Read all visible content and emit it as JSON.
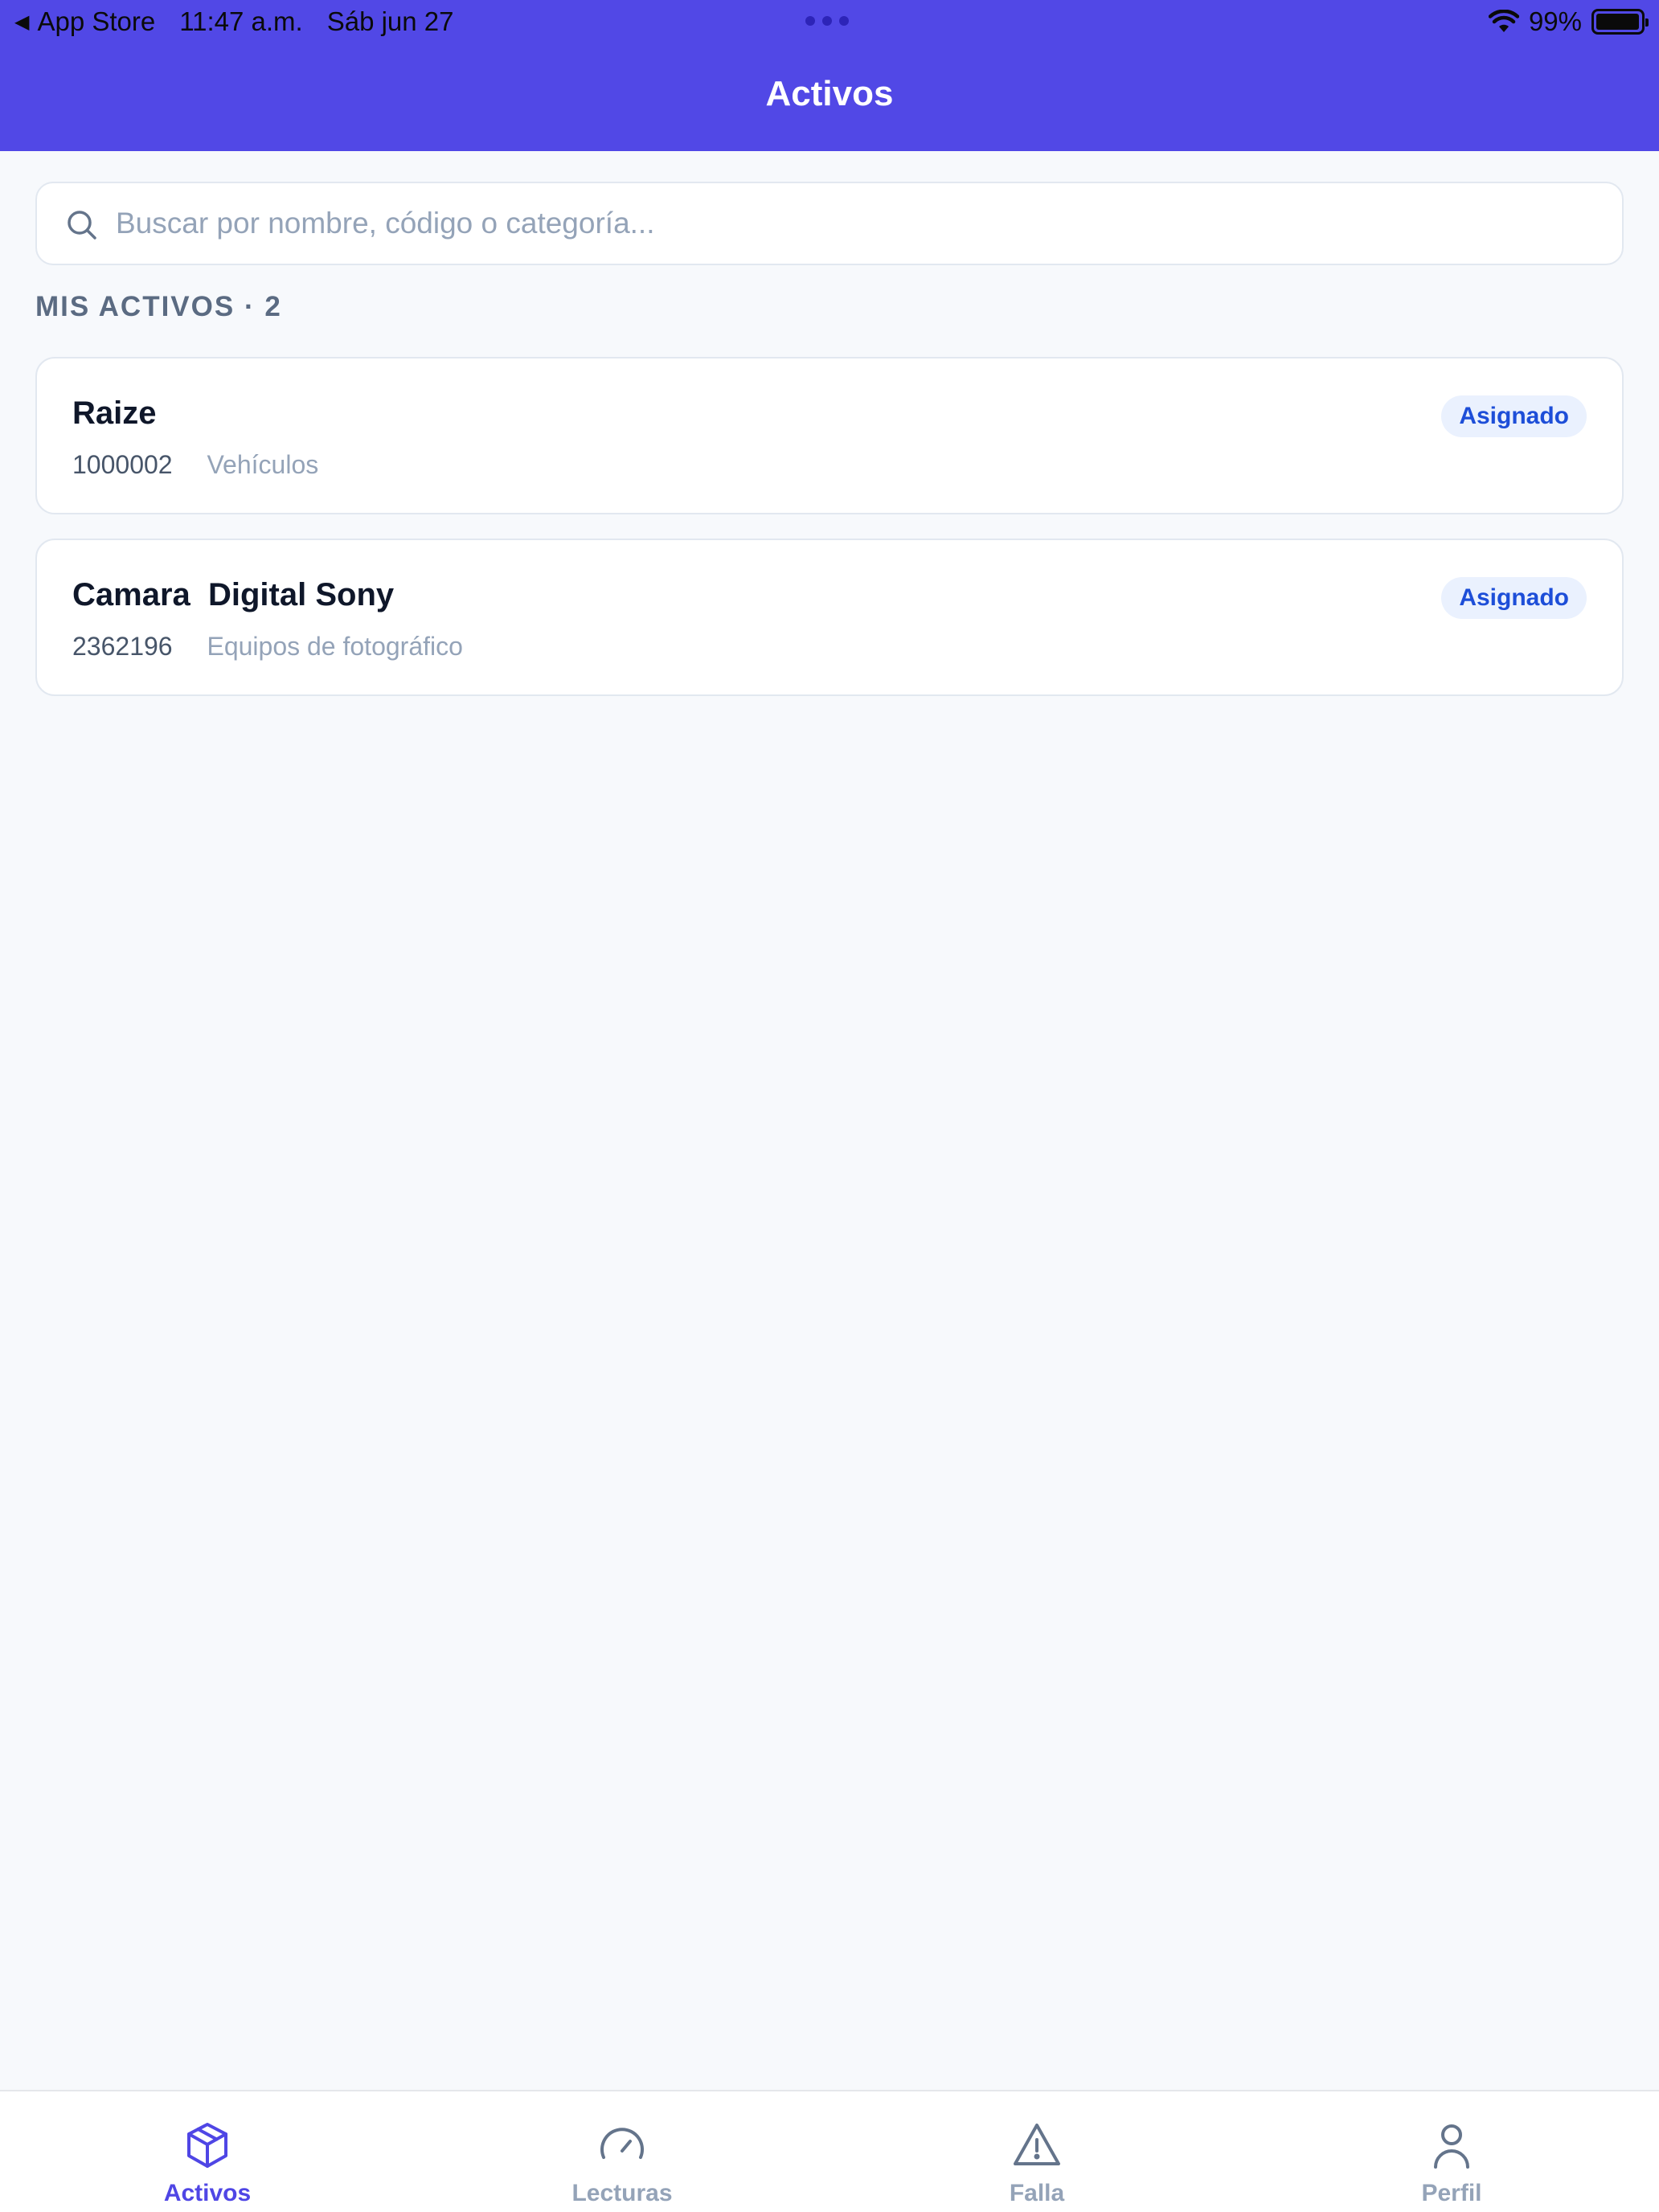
{
  "status_bar": {
    "back_app": "App Store",
    "time": "11:47 a.m.",
    "date": "Sáb jun 27",
    "battery": "99%",
    "battery_level": 0.99
  },
  "header": {
    "title": "Activos"
  },
  "search": {
    "placeholder": "Buscar por nombre, código o categoría...",
    "value": ""
  },
  "section": {
    "label": "MIS ACTIVOS · 2"
  },
  "assets": [
    {
      "name": "Raize",
      "code": "1000002",
      "category": "Vehículos",
      "status": "Asignado"
    },
    {
      "name": "Camara  Digital Sony",
      "code": "2362196",
      "category": "Equipos de fotográfico",
      "status": "Asignado"
    }
  ],
  "tabs": [
    {
      "label": "Activos",
      "icon": "box-icon",
      "active": true
    },
    {
      "label": "Lecturas",
      "icon": "gauge-icon",
      "active": false
    },
    {
      "label": "Falla",
      "icon": "warning-triangle-icon",
      "active": false
    },
    {
      "label": "Perfil",
      "icon": "user-icon",
      "active": false
    }
  ],
  "colors": {
    "header": "#5148e6",
    "accent": "#4f46e5",
    "badge_bg": "#eaf1fe",
    "badge_text": "#1d4ed8"
  }
}
